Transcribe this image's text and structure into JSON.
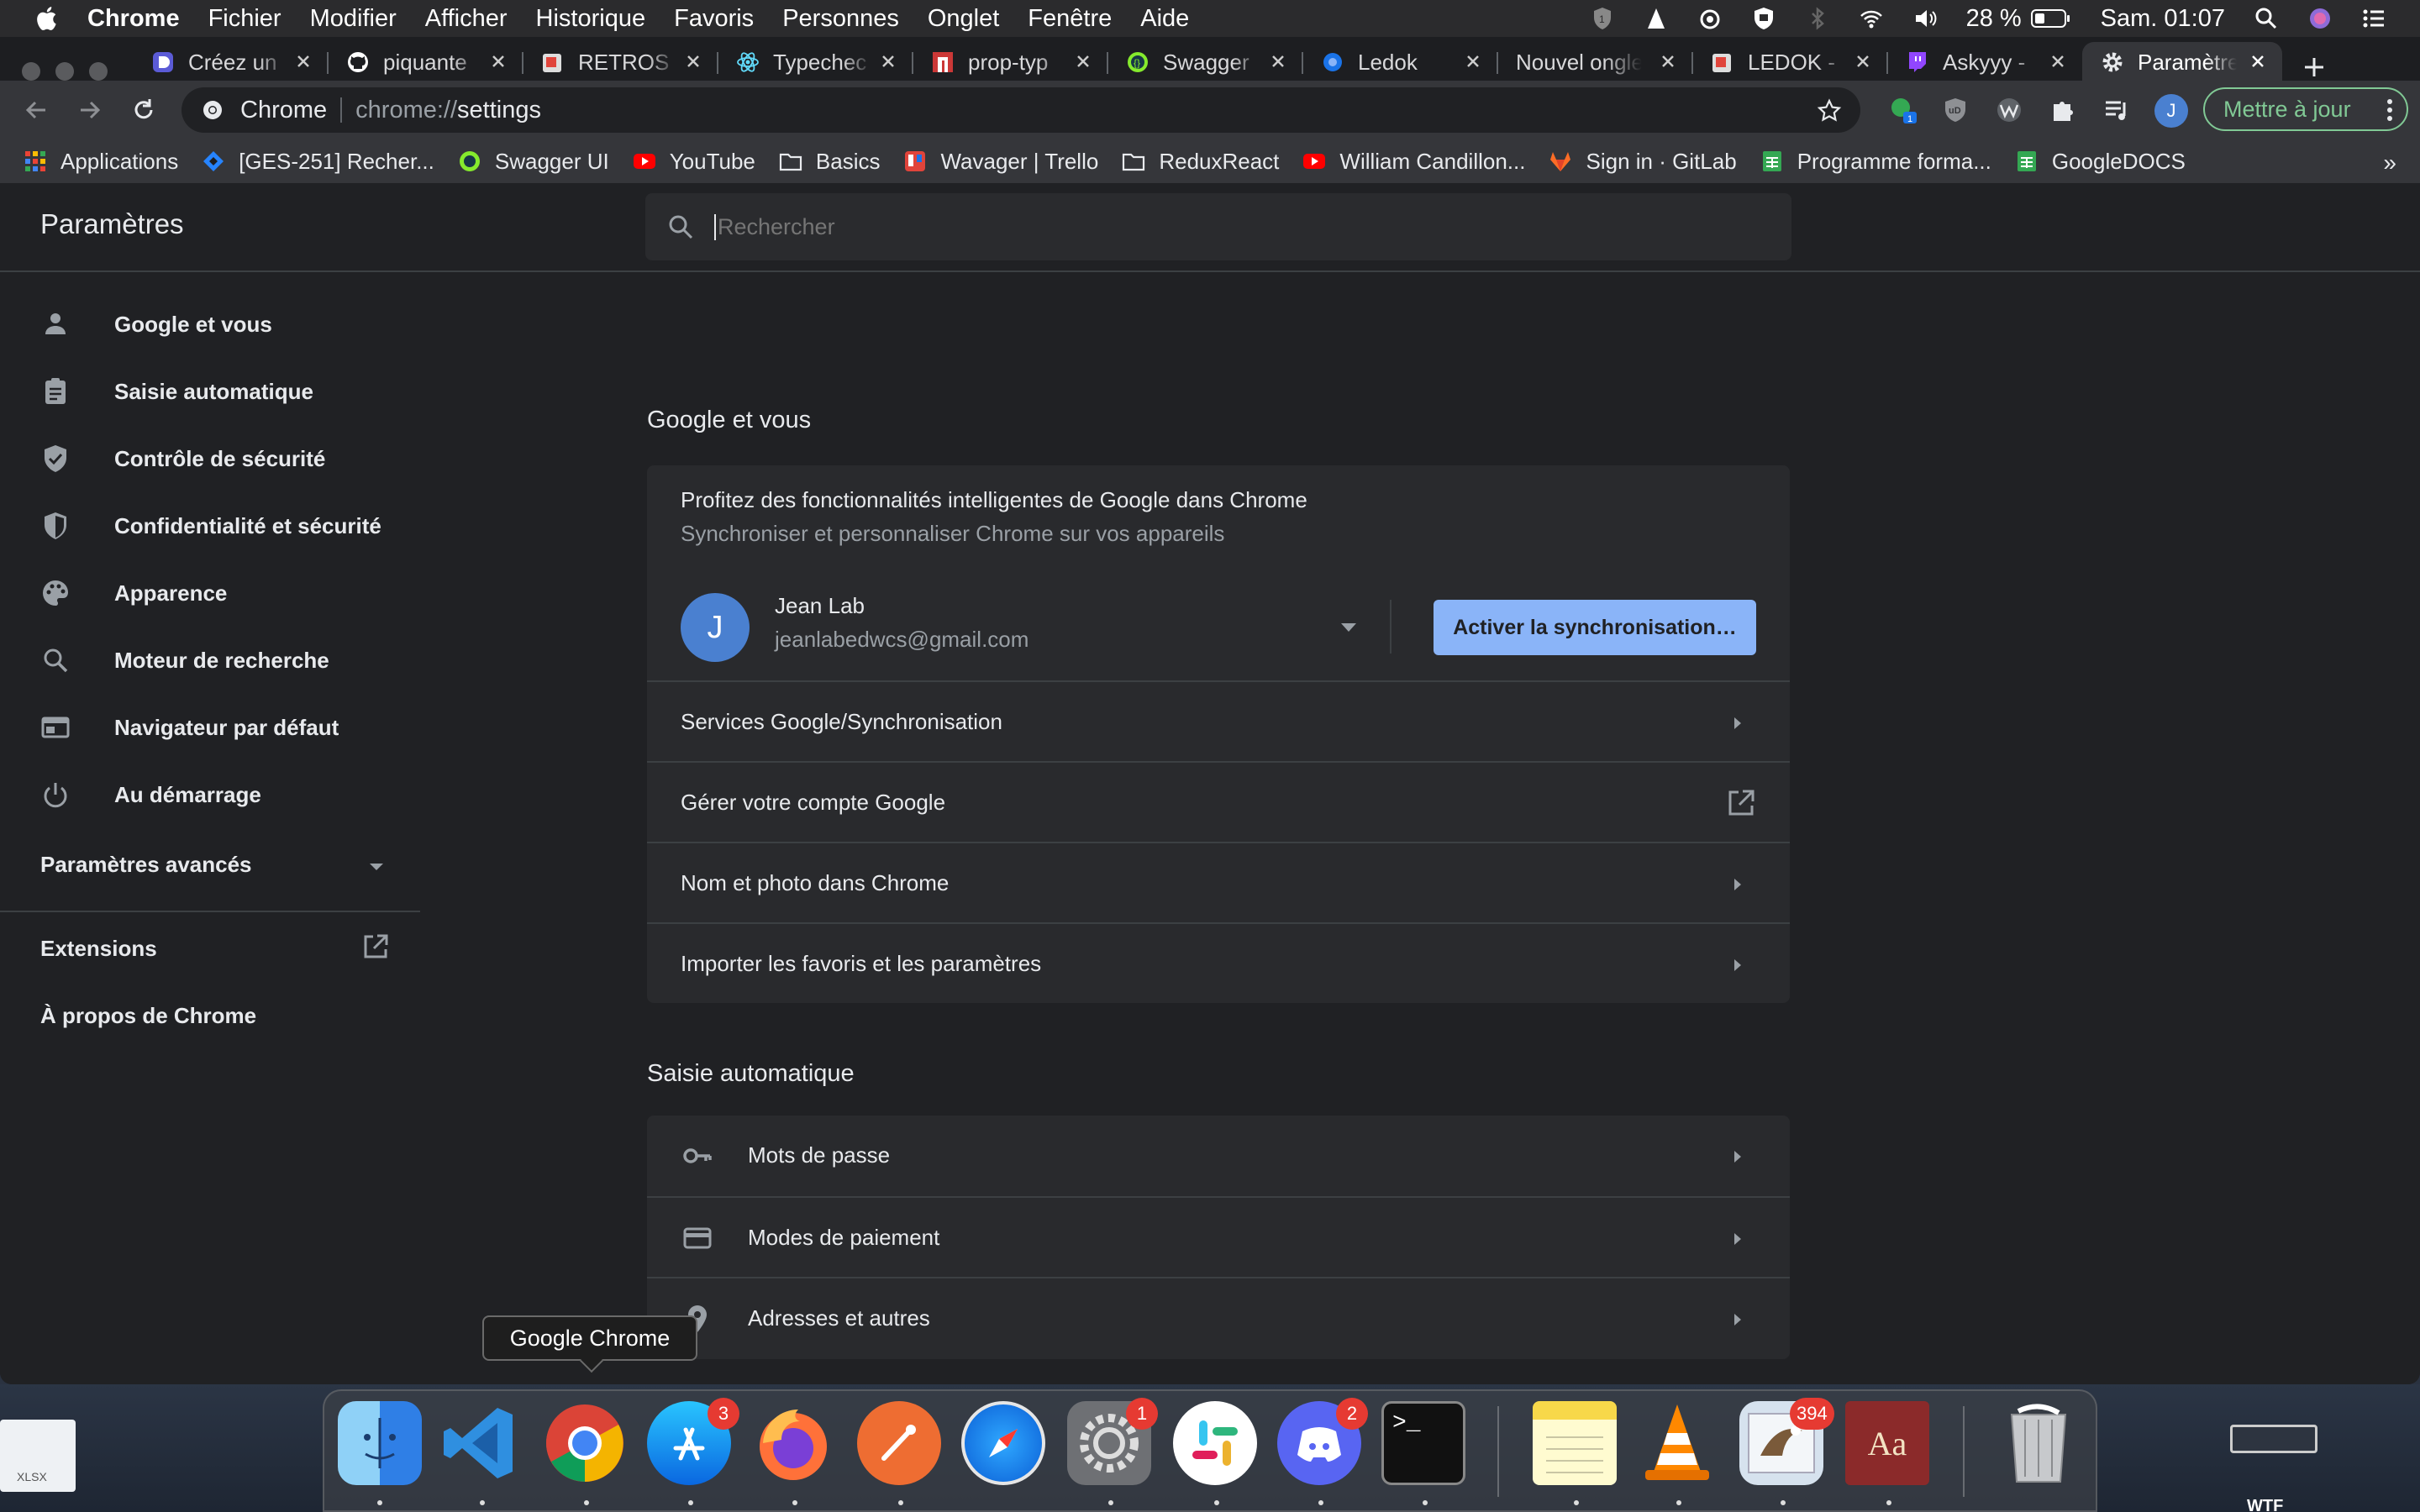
{
  "menubar": {
    "app": "Chrome",
    "items": [
      "Fichier",
      "Modifier",
      "Afficher",
      "Historique",
      "Favoris",
      "Personnes",
      "Onglet",
      "Fenêtre",
      "Aide"
    ],
    "battery": "28 %",
    "datetime": "Sam. 01:07"
  },
  "tabs": [
    {
      "title": "Créez un",
      "icon": "pen-icon",
      "color": "#5b5bd6"
    },
    {
      "title": "piquante",
      "icon": "github-icon",
      "color": "#ffffff"
    },
    {
      "title": "RETROS",
      "icon": "retro-icon",
      "color": "#e0443b"
    },
    {
      "title": "Typechec",
      "icon": "react-icon",
      "color": "#61dafb"
    },
    {
      "title": "prop-typ",
      "icon": "npm-icon",
      "color": "#cb3837"
    },
    {
      "title": "Swagger",
      "icon": "swagger-icon",
      "color": "#85ea2d"
    },
    {
      "title": "Ledok",
      "icon": "ledok-icon",
      "color": "#8ab4f8"
    },
    {
      "title": "Nouvel ongle",
      "icon": "",
      "color": ""
    },
    {
      "title": "LEDOK -",
      "icon": "ledok-icon",
      "color": "#e0443b"
    },
    {
      "title": "Askyyy -",
      "icon": "twitch-icon",
      "color": "#9146ff"
    },
    {
      "title": "Paramètres",
      "icon": "gear-icon",
      "color": "#e8eaed"
    }
  ],
  "omnibox": {
    "chip": "Chrome",
    "scheme": "chrome://",
    "path": "settings"
  },
  "extensions": {
    "badge": "1",
    "avatar": "J"
  },
  "update_button": "Mettre à jour",
  "bookmarks": [
    {
      "label": "Applications",
      "icon": "apps-grid-icon"
    },
    {
      "label": "[GES-251] Recher...",
      "icon": "jira-icon"
    },
    {
      "label": "Swagger UI",
      "icon": "swagger-icon"
    },
    {
      "label": "YouTube",
      "icon": "youtube-icon"
    },
    {
      "label": "Basics",
      "icon": "folder-icon"
    },
    {
      "label": "Wavager | Trello",
      "icon": "trello-icon"
    },
    {
      "label": "ReduxReact",
      "icon": "folder-icon"
    },
    {
      "label": "William Candillon...",
      "icon": "youtube-icon"
    },
    {
      "label": "Sign in · GitLab",
      "icon": "gitlab-icon"
    },
    {
      "label": "Programme forma...",
      "icon": "sheets-icon"
    },
    {
      "label": "GoogleDOCS",
      "icon": "sheets-icon"
    }
  ],
  "bookmarks_more": "»",
  "settings": {
    "title": "Paramètres",
    "search_placeholder": "Rechercher",
    "nav": [
      {
        "label": "Google et vous",
        "icon": "person-icon"
      },
      {
        "label": "Saisie automatique",
        "icon": "clipboard-icon"
      },
      {
        "label": "Contrôle de sécurité",
        "icon": "shield-check-icon"
      },
      {
        "label": "Confidentialité et sécurité",
        "icon": "shield-icon"
      },
      {
        "label": "Apparence",
        "icon": "palette-icon"
      },
      {
        "label": "Moteur de recherche",
        "icon": "search-icon"
      },
      {
        "label": "Navigateur par défaut",
        "icon": "browser-icon"
      },
      {
        "label": "Au démarrage",
        "icon": "power-icon"
      }
    ],
    "advanced": "Paramètres avancés",
    "extensions": "Extensions",
    "about": "À propos de Chrome"
  },
  "google_section": {
    "title": "Google et vous",
    "promo_title": "Profitez des fonctionnalités intelligentes de Google dans Chrome",
    "promo_sub": "Synchroniser et personnaliser Chrome sur vos appareils",
    "avatar": "J",
    "name": "Jean Lab",
    "email": "jeanlabedwcs@gmail.com",
    "sync_button": "Activer la synchronisation…",
    "rows": [
      "Services Google/Synchronisation",
      "Gérer votre compte Google",
      "Nom et photo dans Chrome",
      "Importer les favoris et les paramètres"
    ]
  },
  "autofill_section": {
    "title": "Saisie automatique",
    "rows": [
      {
        "label": "Mots de passe",
        "icon": "key-icon"
      },
      {
        "label": "Modes de paiement",
        "icon": "credit-card-icon"
      },
      {
        "label": "Adresses et autres",
        "icon": "location-pin-icon"
      }
    ]
  },
  "tooltip": "Google Chrome",
  "desktop": {
    "file_label": "XLSX",
    "wtf_label": "WTF"
  },
  "dock": {
    "badges": {
      "appstore": "3",
      "prefs": "1",
      "discord": "2",
      "mail": "394"
    },
    "terminal_prompt": ">_",
    "dictionary_label": "Aa"
  },
  "colors": {
    "accent": "#8ab4f8",
    "update": "#81c995",
    "badge": "#e63a32"
  }
}
